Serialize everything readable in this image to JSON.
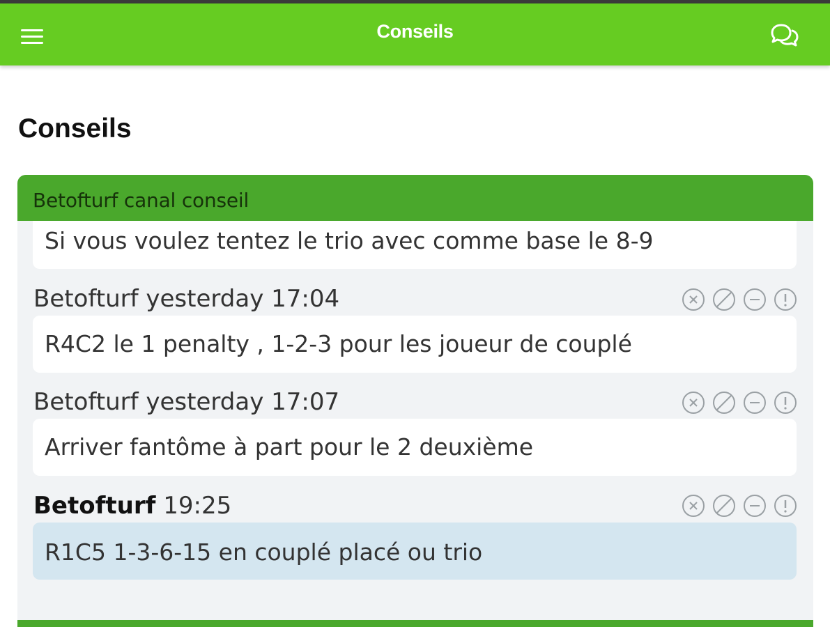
{
  "appbar": {
    "title": "Conseils",
    "menu_icon": "hamburger-menu-icon",
    "chat_icon": "chat-bubbles-icon"
  },
  "page": {
    "title": "Conseils"
  },
  "channel": {
    "name": "Betofturf canal conseil",
    "first_message": "Si vous voulez tentez le trio avec comme base le 8-9",
    "messages": [
      {
        "author": "Betofturf",
        "time": "yesterday 17:04",
        "text": "R4C2 le 1 penalty , 1-2-3 pour les joueur de couplé"
      },
      {
        "author": "Betofturf",
        "time": "yesterday 17:07",
        "text": "Arriver fantôme à part pour le 2 deuxième"
      },
      {
        "author": "Betofturf",
        "time": "19:25",
        "text": "R1C5 1-3-6-15 en couplé placé ou trio"
      }
    ],
    "action_icons": [
      "close-circle-icon",
      "block-icon",
      "minus-circle-icon",
      "alert-circle-icon"
    ]
  },
  "colors": {
    "appbar": "#66cc22",
    "panel_header": "#4aa82c",
    "panel_bg": "#f1f3f5",
    "highlight": "#d4e6f0"
  }
}
